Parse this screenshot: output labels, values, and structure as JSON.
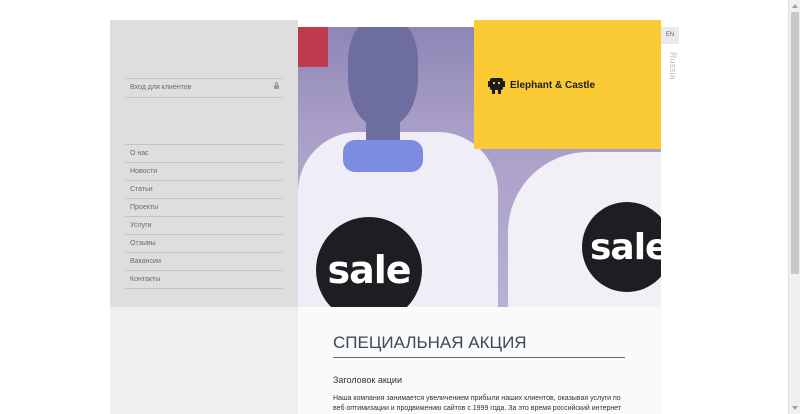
{
  "sidebar": {
    "login_label": "Вход для клиентов",
    "nav": [
      {
        "label": "О нас"
      },
      {
        "label": "Новости"
      },
      {
        "label": "Статьи"
      },
      {
        "label": "Проекты"
      },
      {
        "label": "Услуги"
      },
      {
        "label": "Отзывы"
      },
      {
        "label": "Вакансии"
      },
      {
        "label": "Контакты"
      }
    ]
  },
  "hero": {
    "sale_text_1": "sale",
    "sale_text_2": "sale"
  },
  "brand": {
    "name": "Elephant & Castle",
    "panel_color": "#fbcb36",
    "icon": "elephant-logo-icon"
  },
  "language": {
    "current": "EN",
    "alternate": "Russia"
  },
  "content": {
    "title": "СПЕЦИАЛЬНАЯ АКЦИЯ",
    "subtitle": "Заголовок акции",
    "body": "Наша компания занимается увеличением прибыли наших клиентов, оказывая услуги по веб оптимизации и продвижению сайтов с 1999 года. За это время российский интернет"
  }
}
